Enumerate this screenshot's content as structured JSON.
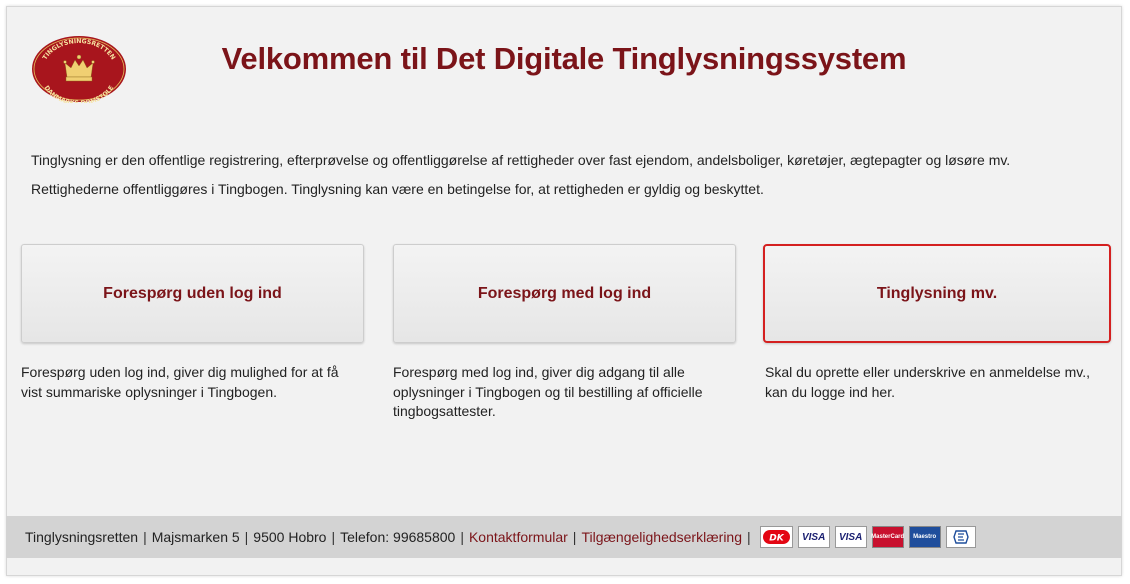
{
  "logo": {
    "top_text": "TINGLYSNINGSRETTEN",
    "bottom_text": "DANMARKS DOMSTOLE"
  },
  "title": "Velkommen til Det Digitale Tinglysningssystem",
  "intro": [
    "Tinglysning er den offentlige registrering, efterprøvelse og offentliggørelse af rettigheder over fast ejendom, andelsboliger, køretøjer, ægtepagter og løsøre mv.",
    "Rettighederne offentliggøres i Tingbogen. Tinglysning kan være en betingelse for, at rettigheden er gyldig og beskyttet."
  ],
  "options": [
    {
      "label": "Forespørg uden log ind",
      "description": "Forespørg uden log ind, giver dig mulighed for at få vist summariske oplysninger i Tingbogen."
    },
    {
      "label": "Forespørg med log ind",
      "description": "Forespørg med log ind, giver dig adgang til alle oplysninger i Tingbogen og til bestilling af officielle tingbogsattester."
    },
    {
      "label": "Tinglysning mv.",
      "description": "Skal du oprette eller underskrive en anmeldelse mv., kan du logge ind her."
    }
  ],
  "footer": {
    "org": "Tinglysningsretten",
    "address": "Majsmarken 5",
    "city": "9500 Hobro",
    "phone": "Telefon: 99685800",
    "contact_link": "Kontaktformular",
    "accessibility_link": "Tilgængelighedserklæring",
    "separator": "|",
    "payment_cards": {
      "dankort": "DK",
      "visa1": "VISA",
      "visa2": "VISA",
      "mastercard": "MasterCard",
      "maestro": "Maestro"
    }
  },
  "colors": {
    "brand": "#7b1419",
    "active_border": "#d42020",
    "background": "#f2f2f2",
    "footer_bg": "#d3d3d3"
  }
}
